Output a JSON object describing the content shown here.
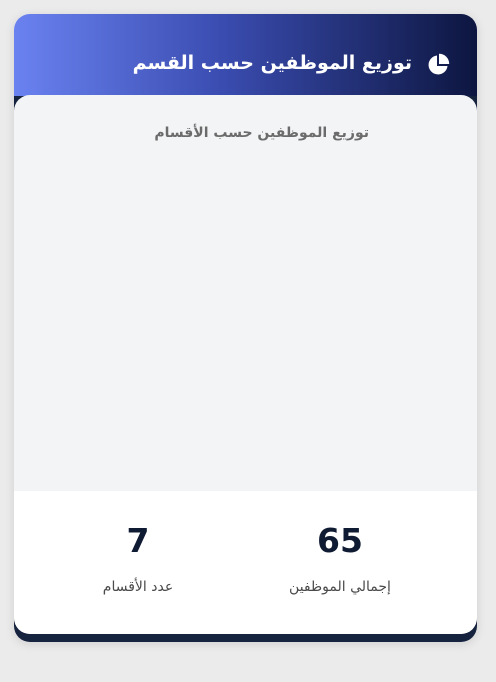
{
  "card": {
    "title": "توزيع الموظفين حسب القسم",
    "icon": "pie-chart-icon",
    "accent_gradient": [
      "#6a82f0",
      "#0d1640"
    ]
  },
  "chart": {
    "title": "توزيع الموظفين حسب الأقسام"
  },
  "stats": {
    "total_employees": {
      "value": "65",
      "label": "إجمالي الموظفين"
    },
    "departments_count": {
      "value": "7",
      "label": "عدد الأقسام"
    }
  }
}
